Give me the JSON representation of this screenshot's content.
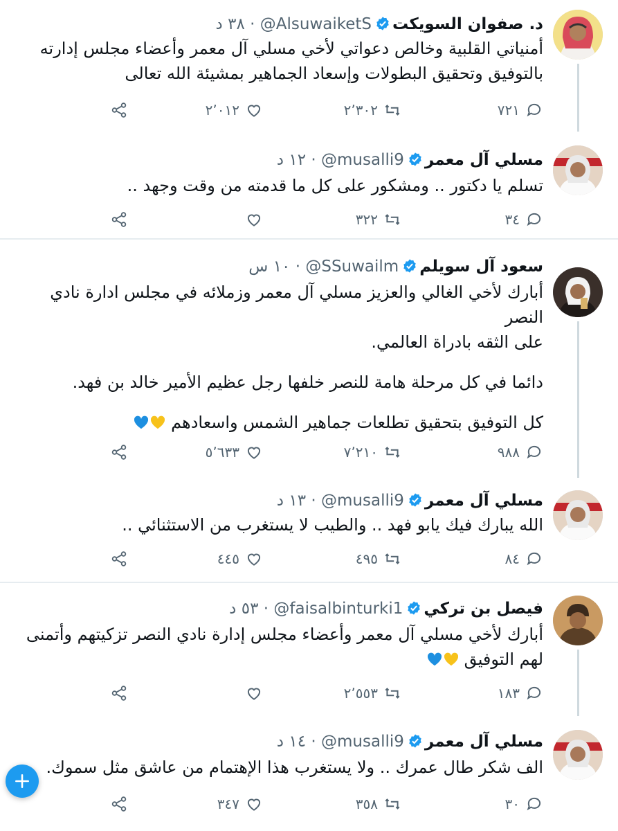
{
  "tweets": [
    {
      "name": "د. صفوان السويكت",
      "handle": "@AlsuwaiketS",
      "time": "٣٨ د",
      "lines": [
        "أمنياتي القلبية وخالص دعواتي لأخي مسلي آل معمر وأعضاء مجلس إدارته",
        "بالتوفيق وتحقيق البطولات وإسعاد الجماهير بمشيئة الله تعالى"
      ],
      "replies": "٧٢١",
      "retweets": "٢٬٣٠٢",
      "likes": "٢٬٠١٢"
    },
    {
      "name": "مسلي آل معمر",
      "handle": "@musalli9",
      "time": "١٢ د",
      "lines": [
        "تسلم يا دكتور .. ومشكور على كل ما قدمته من وقت وجهد .."
      ],
      "replies": "٣٤",
      "retweets": "٣٢٢",
      "likes": ""
    },
    {
      "name": "سعود آل سويلم",
      "handle": "@SSuwailm",
      "time": "١٠ س",
      "para1": [
        "أبارك لأخي الغالي والعزيز مسلي آل معمر وزملائه في مجلس ادارة نادي النصر",
        "على الثقه بادراة العالمي."
      ],
      "para2": "دائما في كل مرحلة هامة للنصر خلفها رجل عظيم الأمير خالد بن فهد.",
      "para3": "كل التوفيق بتحقيق تطلعات جماهير الشمس واسعادهم",
      "replies": "٩٨٨",
      "retweets": "٧٬٢١٠",
      "likes": "٥٬٦٣٣"
    },
    {
      "name": "مسلي آل معمر",
      "handle": "@musalli9",
      "time": "١٣ د",
      "lines": [
        "الله يبارك فيك يابو فهد .. والطيب لا يستغرب من الاستثنائي .."
      ],
      "replies": "٨٤",
      "retweets": "٤٩٥",
      "likes": "٤٤٥"
    },
    {
      "name": "فيصل بن تركي",
      "handle": "@faisalbinturki1",
      "time": "٥٣ د",
      "lines": [
        "أبارك لأخي مسلي آل معمر وأعضاء مجلس إدارة نادي النصر تزكيتهم وأتمنى",
        "لهم التوفيق"
      ],
      "replies": "١٨٣",
      "retweets": "٢٬٥٥٣",
      "likes": ""
    },
    {
      "name": "مسلي آل معمر",
      "handle": "@musalli9",
      "time": "١٤ د",
      "lines": [
        "الف شكر طال عمرك .. ولا يستغرب هذا الإهتمام من عاشق مثل سموك."
      ],
      "replies": "٣٠",
      "retweets": "٣٥٨",
      "likes": "٣٤٧"
    }
  ],
  "dot": "·",
  "icons": {
    "reply": "reply-icon",
    "retweet": "retweet-icon",
    "like": "heart-icon",
    "share": "share-icon",
    "verified": "verified-badge-icon",
    "compose": "plus-icon"
  },
  "colors": {
    "accent": "#1d9bf0",
    "muted": "#536471",
    "thread_line": "#cfd9de",
    "heart_yellow": "#f7c21b",
    "heart_blue": "#1d8fe0"
  }
}
